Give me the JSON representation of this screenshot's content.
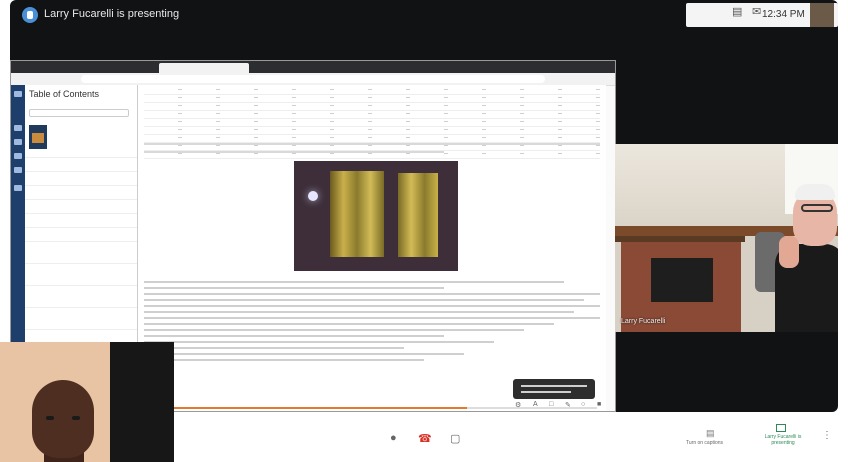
{
  "meeting": {
    "presenter_banner": "Larry Fucarelli is presenting",
    "time": "12:34 PM"
  },
  "topbar": {
    "icons": [
      "people-icon",
      "chat-icon"
    ]
  },
  "shared_screen": {
    "toc_title": "Table of Contents",
    "participant_name": "Larry Fucarelli"
  },
  "controls": {
    "captions_label": "Turn on captions",
    "presenting_label": "Larry Fucarelli is presenting",
    "icons": [
      "microphone-icon",
      "end-call-icon",
      "camera-icon",
      "more-options-icon"
    ]
  },
  "colors": {
    "meet_background": "#111214",
    "end_call": "#d93025",
    "presenting_accent": "#2e8b57",
    "toc_sidebar": "#1e3e6c"
  }
}
